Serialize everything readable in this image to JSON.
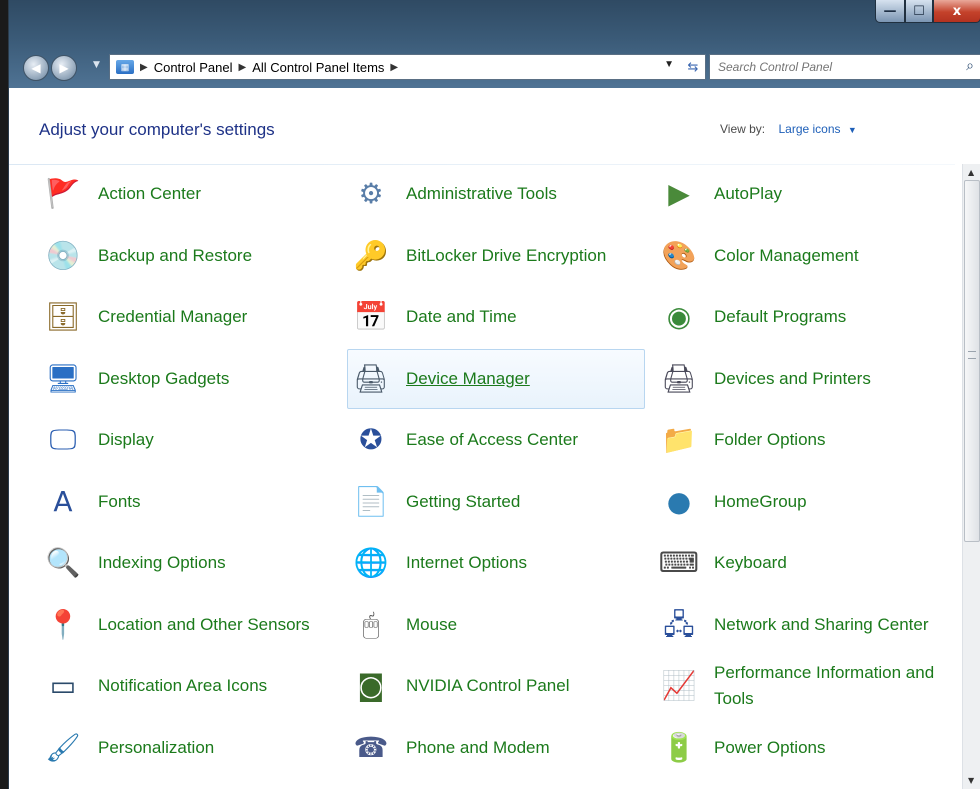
{
  "window": {
    "buttons": {
      "minimize": "—",
      "maximize": "☐",
      "close": "x"
    }
  },
  "nav": {
    "back": "◀",
    "forward": "▶",
    "breadcrumb": [
      "Control Panel",
      "All Control Panel Items"
    ],
    "crumb_separator": "▶",
    "search_placeholder": "Search Control Panel"
  },
  "header": {
    "title": "Adjust your computer's settings",
    "view_by_label": "View by:",
    "view_by_value": "Large icons"
  },
  "items": [
    {
      "label": "Action Center",
      "icon": "flag-icon",
      "glyph": "🚩"
    },
    {
      "label": "Administrative Tools",
      "icon": "admin-tools-icon",
      "glyph": "⚙"
    },
    {
      "label": "AutoPlay",
      "icon": "autoplay-icon",
      "glyph": "▶"
    },
    {
      "label": "Backup and Restore",
      "icon": "backup-icon",
      "glyph": "💿"
    },
    {
      "label": "BitLocker Drive Encryption",
      "icon": "bitlocker-icon",
      "glyph": "🔑"
    },
    {
      "label": "Color Management",
      "icon": "color-management-icon",
      "glyph": "🎨"
    },
    {
      "label": "Credential Manager",
      "icon": "credential-vault-icon",
      "glyph": "🗄"
    },
    {
      "label": "Date and Time",
      "icon": "calendar-clock-icon",
      "glyph": "📅"
    },
    {
      "label": "Default Programs",
      "icon": "default-programs-icon",
      "glyph": "◉"
    },
    {
      "label": "Desktop Gadgets",
      "icon": "gadgets-icon",
      "glyph": "🖥"
    },
    {
      "label": "Device Manager",
      "icon": "device-manager-icon",
      "glyph": "🖨",
      "hover": true
    },
    {
      "label": "Devices and Printers",
      "icon": "printer-icon",
      "glyph": "🖨"
    },
    {
      "label": "Display",
      "icon": "display-icon",
      "glyph": "🖵"
    },
    {
      "label": "Ease of Access Center",
      "icon": "ease-of-access-icon",
      "glyph": "✪"
    },
    {
      "label": "Folder Options",
      "icon": "folder-icon",
      "glyph": "📁"
    },
    {
      "label": "Fonts",
      "icon": "fonts-icon",
      "glyph": "A"
    },
    {
      "label": "Getting Started",
      "icon": "getting-started-icon",
      "glyph": "📄"
    },
    {
      "label": "HomeGroup",
      "icon": "homegroup-icon",
      "glyph": "●"
    },
    {
      "label": "Indexing Options",
      "icon": "magnifier-icon",
      "glyph": "🔍"
    },
    {
      "label": "Internet Options",
      "icon": "globe-icon",
      "glyph": "🌐"
    },
    {
      "label": "Keyboard",
      "icon": "keyboard-icon",
      "glyph": "⌨"
    },
    {
      "label": "Location and Other Sensors",
      "icon": "location-icon",
      "glyph": "📍"
    },
    {
      "label": "Mouse",
      "icon": "mouse-icon",
      "glyph": "🖱"
    },
    {
      "label": "Network and Sharing Center",
      "icon": "network-icon",
      "glyph": "🖧"
    },
    {
      "label": "Notification Area Icons",
      "icon": "notification-area-icon",
      "glyph": "▭"
    },
    {
      "label": "NVIDIA Control Panel",
      "icon": "nvidia-icon",
      "glyph": "◙"
    },
    {
      "label": "Performance Information and Tools",
      "icon": "performance-icon",
      "glyph": "📈"
    },
    {
      "label": "Personalization",
      "icon": "personalization-icon",
      "glyph": "🖌"
    },
    {
      "label": "Phone and Modem",
      "icon": "phone-icon",
      "glyph": "☎"
    },
    {
      "label": "Power Options",
      "icon": "battery-icon",
      "glyph": "🔋"
    }
  ],
  "colors": {
    "link_green": "#1b7a1b",
    "title_blue": "#1e3287",
    "accent_blue": "#1e5fb8",
    "hover_border": "#b8d6f0"
  }
}
